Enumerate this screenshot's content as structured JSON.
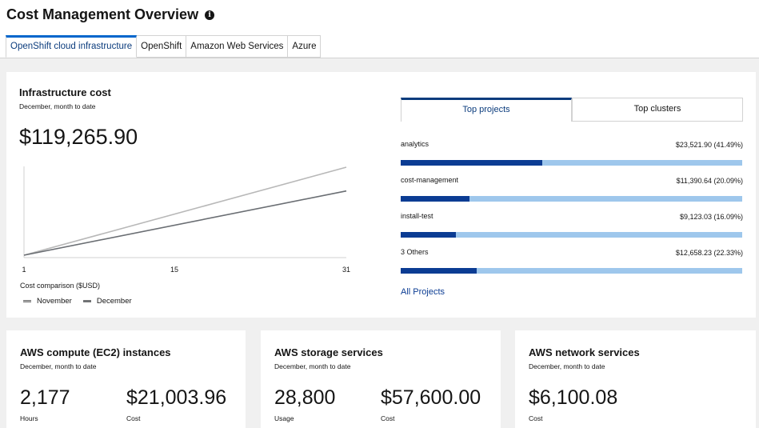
{
  "header": {
    "title": "Cost Management Overview",
    "info_icon": "info-circle-icon",
    "tabs": [
      {
        "label": "OpenShift cloud infrastructure",
        "active": true
      },
      {
        "label": "OpenShift",
        "active": false
      },
      {
        "label": "Amazon Web Services",
        "active": false
      },
      {
        "label": "Azure",
        "active": false
      }
    ]
  },
  "infra_card": {
    "title": "Infrastructure cost",
    "subtitle": "December, month to date",
    "total": "$119,265.90",
    "chart_caption": "Cost comparison ($USD)"
  },
  "chart_data": {
    "type": "line",
    "x_ticks": [
      "1",
      "15",
      "31"
    ],
    "xlim": [
      1,
      31
    ],
    "series": [
      {
        "name": "November",
        "x": [
          1,
          31
        ],
        "y": [
          0,
          1.0
        ]
      },
      {
        "name": "December",
        "x": [
          1,
          31
        ],
        "y": [
          0,
          0.73
        ]
      }
    ],
    "xlabel": "Cost comparison ($USD)",
    "legend": "bottom-left",
    "colors": {
      "November": "#b8b8b8",
      "December": "#6a6e73"
    }
  },
  "top_tabs": {
    "projects_label": "Top projects",
    "clusters_label": "Top clusters",
    "active": "projects"
  },
  "projects": [
    {
      "name": "analytics",
      "value": "$23,521.90 (41.49%)",
      "percent": 41.49
    },
    {
      "name": "cost-management",
      "value": "$11,390.64 (20.09%)",
      "percent": 20.09
    },
    {
      "name": "install-test",
      "value": "$9,123.03 (16.09%)",
      "percent": 16.09
    },
    {
      "name": "3 Others",
      "value": "$12,658.23 (22.33%)",
      "percent": 22.33
    }
  ],
  "all_projects_link": "All Projects",
  "cards": {
    "compute": {
      "title": "AWS compute (EC2) instances",
      "subtitle": "December, month to date",
      "m1_value": "2,177",
      "m1_label": "Hours",
      "m2_value": "$21,003.96",
      "m2_label": "Cost"
    },
    "storage": {
      "title": "AWS storage services",
      "subtitle": "December, month to date",
      "m1_value": "28,800",
      "m1_label": "Usage",
      "m2_value": "$57,600.00",
      "m2_label": "Cost"
    },
    "network": {
      "title": "AWS network services",
      "subtitle": "December, month to date",
      "m1_value": "$6,100.08",
      "m1_label": "Cost"
    }
  },
  "colors": {
    "accent": "#0066cc",
    "bar_fill": "#0b3c93",
    "bar_track": "#9ec7ec",
    "background": "#f0f0f0"
  }
}
